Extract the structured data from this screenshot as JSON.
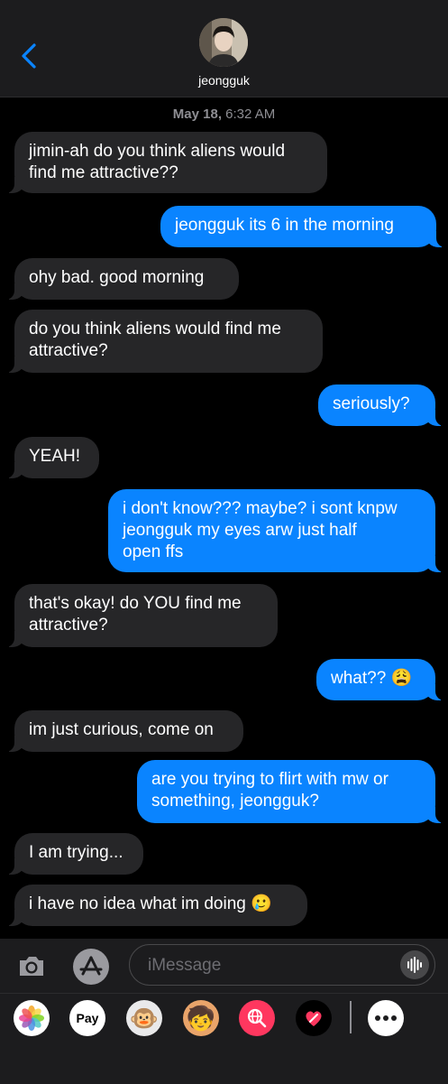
{
  "header": {
    "contact_name": "jeongguk",
    "back_icon": "chevron-left-icon",
    "accent": "#0a84ff"
  },
  "thread": {
    "date_label": "May 18,",
    "time_label": "6:32 AM",
    "messages": [
      {
        "from": "them",
        "text": "jimin-ah do you think aliens would\nfind me attractive??"
      },
      {
        "from": "me",
        "text": "jeongguk its 6 in the morning"
      },
      {
        "from": "them",
        "text": "ohy bad. good morning"
      },
      {
        "from": "them",
        "text": "do you think aliens would find me\nattractive?"
      },
      {
        "from": "me",
        "text": "seriously?"
      },
      {
        "from": "them",
        "text": "YEAH!"
      },
      {
        "from": "me",
        "text": "i don't know??? maybe? i sont knpw\njeongguk my eyes arw just half\nopen ffs"
      },
      {
        "from": "them",
        "text": "that's okay! do YOU find me\nattractive?"
      },
      {
        "from": "me",
        "text": "what?? 😩"
      },
      {
        "from": "them",
        "text": "im just curious, come on"
      },
      {
        "from": "me",
        "text": "are you trying to flirt with mw or\nsomething, jeongguk?"
      },
      {
        "from": "them",
        "text": "I am trying..."
      },
      {
        "from": "them",
        "text": "i have no idea what im doing 🥲"
      }
    ]
  },
  "composer": {
    "placeholder": "iMessage",
    "camera_icon": "camera-icon",
    "apps_icon": "app-store-icon",
    "audio_icon": "waveform-icon"
  },
  "app_drawer": {
    "items": [
      {
        "name": "photos-icon"
      },
      {
        "name": "apple-pay-icon",
        "label": "Pay"
      },
      {
        "name": "animoji-monkey-icon",
        "glyph": "🐵"
      },
      {
        "name": "memoji-icon",
        "glyph": "🧒"
      },
      {
        "name": "web-search-icon"
      },
      {
        "name": "digital-touch-icon"
      },
      {
        "name": "more-apps-icon"
      }
    ]
  }
}
